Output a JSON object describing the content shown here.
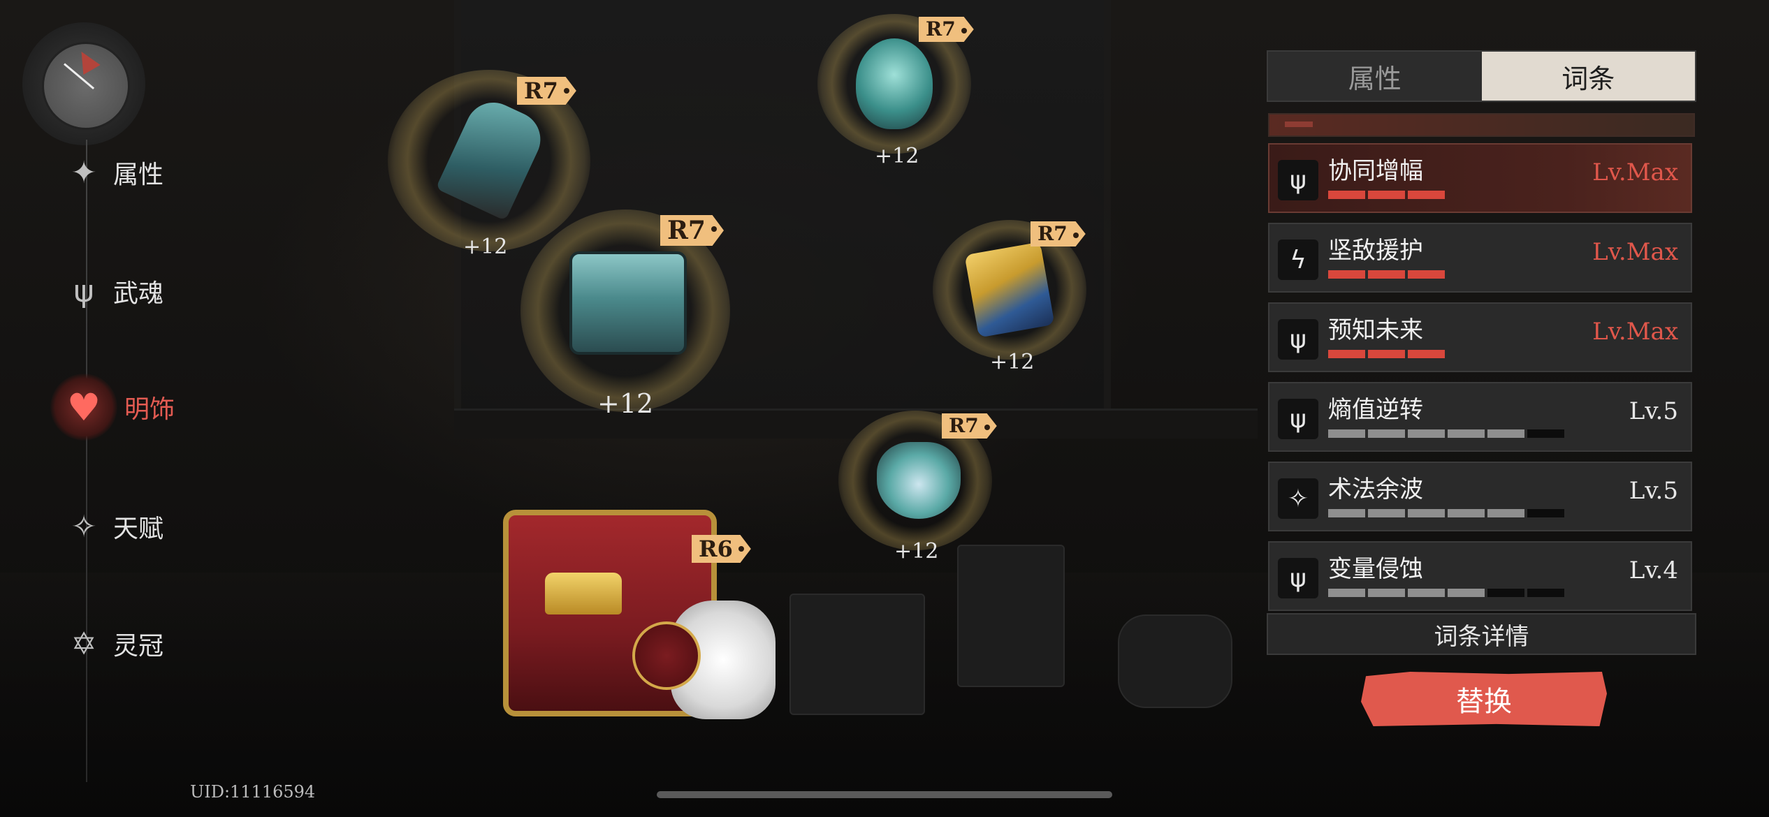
{
  "uid": "UID:11116594",
  "nav": {
    "items": [
      {
        "label": "属性",
        "icon": "star-icon"
      },
      {
        "label": "武魂",
        "icon": "trident-icon"
      },
      {
        "label": "明饰",
        "icon": "heart-icon"
      },
      {
        "label": "天赋",
        "icon": "compass-star-icon"
      },
      {
        "label": "灵冠",
        "icon": "hexagram-icon"
      }
    ],
    "active": "明饰"
  },
  "equipment": [
    {
      "name": "key",
      "rank": "R7",
      "level": "+12"
    },
    {
      "name": "mask",
      "rank": "R7",
      "level": "+12"
    },
    {
      "name": "chest",
      "rank": "R7",
      "level": "+12"
    },
    {
      "name": "tome",
      "rank": "R7",
      "level": "+12"
    },
    {
      "name": "amulet",
      "rank": "R7",
      "level": "+12"
    },
    {
      "name": "treasure-chest",
      "rank": "R6"
    }
  ],
  "panel": {
    "tabs": [
      {
        "label": "属性",
        "selected": false
      },
      {
        "label": "词条",
        "selected": true
      }
    ],
    "affixes": [
      {
        "name": "协同增幅",
        "level": "Lv.Max",
        "max": true,
        "filled": 3,
        "total": 3,
        "icon": "trident-icon"
      },
      {
        "name": "坚敌援护",
        "level": "Lv.Max",
        "max": true,
        "filled": 3,
        "total": 3,
        "icon": "lightning-icon"
      },
      {
        "name": "预知未来",
        "level": "Lv.Max",
        "max": true,
        "filled": 3,
        "total": 3,
        "icon": "trident-icon"
      },
      {
        "name": "熵值逆转",
        "level": "Lv.5",
        "max": false,
        "filled": 5,
        "total": 6,
        "icon": "trident-icon"
      },
      {
        "name": "术法余波",
        "level": "Lv.5",
        "max": false,
        "filled": 5,
        "total": 6,
        "icon": "shards-icon"
      },
      {
        "name": "变量侵蚀",
        "level": "Lv.4",
        "max": false,
        "filled": 4,
        "total": 6,
        "icon": "trident-icon"
      }
    ],
    "detail_button": "词条详情",
    "replace_button": "替换"
  },
  "colors": {
    "accent_red": "#e0594d",
    "rank_tag": "#f0bf7e",
    "max_level": "#e0574b"
  }
}
